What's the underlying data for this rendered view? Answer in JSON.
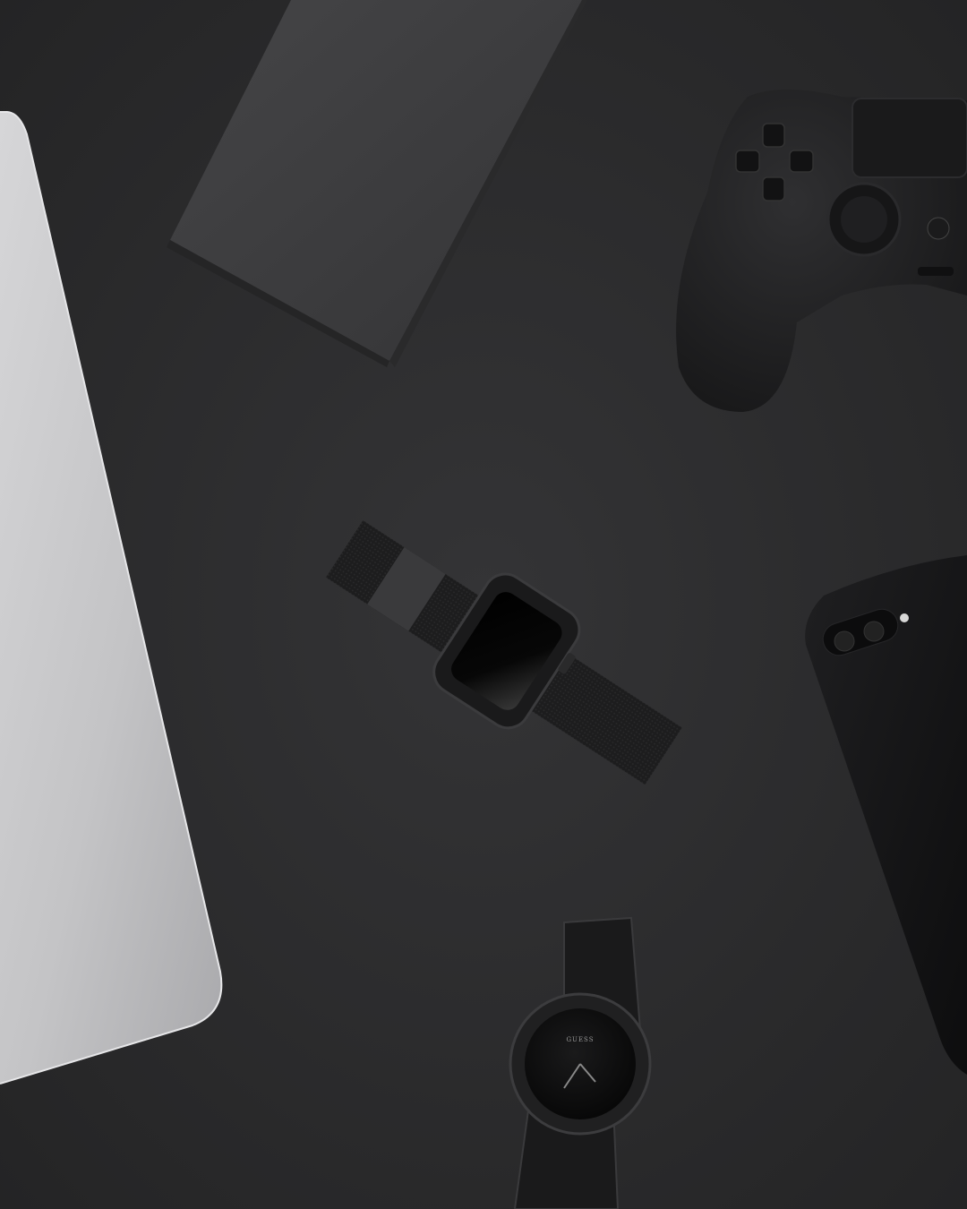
{
  "scene": {
    "description_free": true,
    "surface_color": "#2b2b2c",
    "objects": [
      {
        "name": "laptop",
        "color": "#c9c9cb"
      },
      {
        "name": "box",
        "color": "#3a3a3c"
      },
      {
        "name": "game-controller",
        "color": "#1e1e20"
      },
      {
        "name": "smartwatch",
        "color": "#1a1a1b"
      },
      {
        "name": "smartphone",
        "color": "#121213"
      },
      {
        "name": "wristwatch",
        "color": "#1c1c1d"
      }
    ]
  },
  "wristwatch": {
    "brand_text": "GUESS"
  }
}
